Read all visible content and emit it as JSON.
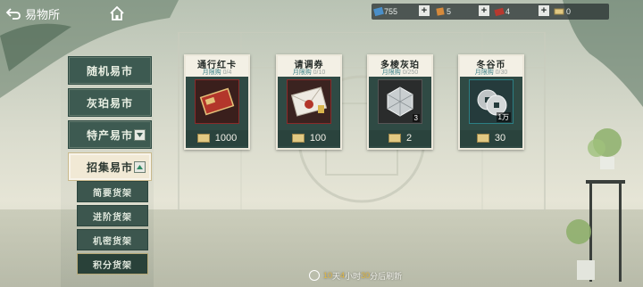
{
  "header": {
    "back_label": "易物所",
    "icons": [
      "back-arrow-icon",
      "home-icon"
    ]
  },
  "resources": [
    {
      "icon": "blue-ticket-icon",
      "value": "755"
    },
    {
      "icon": "orange-gem-icon",
      "value": "5"
    },
    {
      "icon": "red-card-icon",
      "value": "4"
    },
    {
      "icon": "coin-stack-icon",
      "value": "0"
    }
  ],
  "sidebar": {
    "tabs": [
      {
        "label": "随机易市"
      },
      {
        "label": "灰珀易市"
      },
      {
        "label": "特产易市"
      },
      {
        "label": "招集易市",
        "active": true
      }
    ],
    "subtabs": [
      {
        "label": "简要货架"
      },
      {
        "label": "进阶货架"
      },
      {
        "label": "机密货架"
      },
      {
        "label": "积分货架",
        "active": true
      }
    ]
  },
  "shop": {
    "items": [
      {
        "name": "通行红卡",
        "limit_label": "月限购",
        "limit_value": "0/4",
        "price": "1000",
        "badge": "",
        "icon": "red-card-icon"
      },
      {
        "name": "请调券",
        "limit_label": "月限购",
        "limit_value": "0/10",
        "price": "100",
        "badge": "",
        "icon": "envelope-seal-icon"
      },
      {
        "name": "多棱灰珀",
        "limit_label": "月限购",
        "limit_value": "0/250",
        "price": "2",
        "badge": "3",
        "icon": "crystal-cube-icon"
      },
      {
        "name": "冬谷币",
        "limit_label": "月限购",
        "limit_value": "0/30",
        "price": "30",
        "badge": "1万",
        "icon": "silver-coins-icon"
      }
    ],
    "currency_icon": "coin-stack-icon"
  },
  "refresh": {
    "d": "10",
    "d_unit": "天",
    "h": "4",
    "h_unit": "小时",
    "m": "30",
    "m_unit": "分后刷新"
  },
  "colors": {
    "panel_green": "#3d5a51",
    "active_tab": "#f1e9d5",
    "limit_teal": "#3a7f86",
    "highlight_gold": "#e3b945"
  }
}
